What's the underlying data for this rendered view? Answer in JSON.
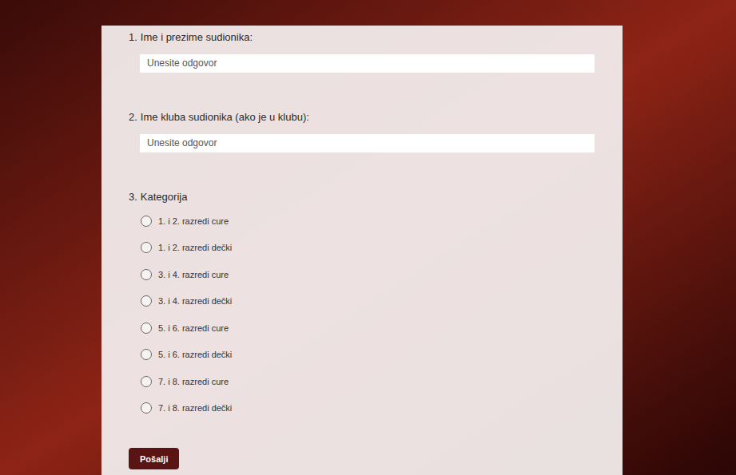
{
  "form": {
    "questions": [
      {
        "number": "1.",
        "label": "Ime i prezime sudionika:",
        "kind": "text",
        "placeholder": "Unesite odgovor"
      },
      {
        "number": "2.",
        "label": "Ime kluba sudionika (ako je u klubu):",
        "kind": "text",
        "placeholder": "Unesite odgovor"
      },
      {
        "number": "3.",
        "label": "Kategorija",
        "kind": "radio",
        "options": [
          {
            "label": "1. i 2. razredi cure",
            "selected": false
          },
          {
            "label": "1. i 2. razredi dečki",
            "selected": false
          },
          {
            "label": "3. i 4. razredi cure",
            "selected": false
          },
          {
            "label": "3. i 4. razredi dečki",
            "selected": false
          },
          {
            "label": "5. i 6. razredi cure",
            "selected": false
          },
          {
            "label": "5. i 6. razredi dečki",
            "selected": false
          },
          {
            "label": "7. i 8. razredi cure",
            "selected": false
          },
          {
            "label": "7. i 8. razredi dečki",
            "selected": false
          }
        ]
      }
    ],
    "submit": "Pošalji"
  }
}
